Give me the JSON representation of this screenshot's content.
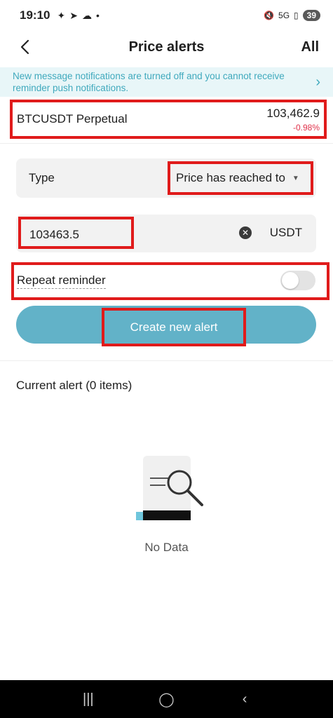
{
  "status_bar": {
    "time": "19:10",
    "battery": "39"
  },
  "header": {
    "title": "Price alerts",
    "all_label": "All"
  },
  "notice": {
    "text": "New message notifications are turned off and you cannot receive reminder push notifications."
  },
  "pair": {
    "name": "BTCUSDT Perpetual",
    "price": "103,462.9",
    "change": "-0.98%"
  },
  "form": {
    "type_label": "Type",
    "type_value": "Price has reached to",
    "price_value": "103463.5",
    "unit": "USDT",
    "repeat_label": "Repeat reminder",
    "repeat_enabled": false,
    "create_label": "Create new alert"
  },
  "alerts": {
    "section_title": "Current alert (0 items)",
    "empty_text": "No Data"
  },
  "colors": {
    "accent": "#62b2c8",
    "notice_bg": "#e8f6f8",
    "negative": "#e0324b",
    "highlight": "#e01b1b"
  }
}
